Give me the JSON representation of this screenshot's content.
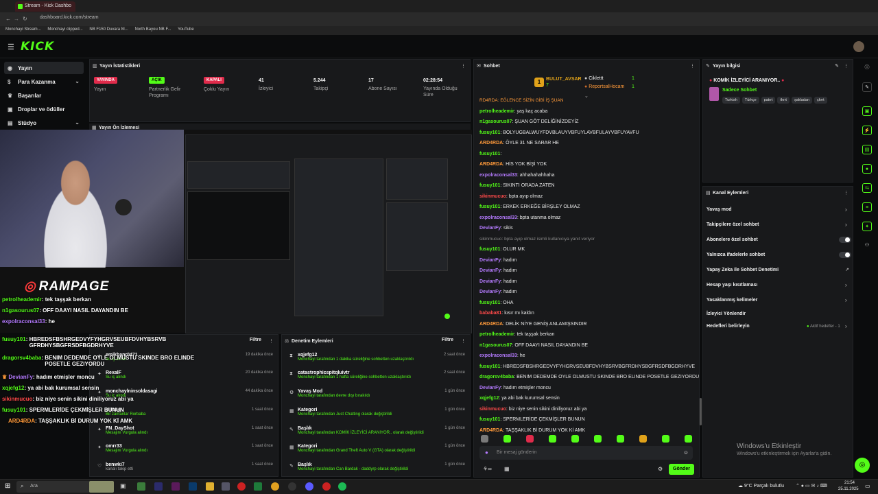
{
  "browser": {
    "tab_title": "Stream - Kick Dashbo",
    "url": "dashboard.kick.com/stream",
    "bookmarks": [
      "Monchayi Stream...",
      "Monchayi clipped...",
      "NB F150 Duvara M...",
      "North Bayou NB F...",
      "YouTube"
    ]
  },
  "header": {
    "logo": "KICK"
  },
  "sidebar": {
    "items": [
      {
        "label": "Yayın",
        "icon": "broadcast-icon"
      },
      {
        "label": "Para Kazanma",
        "icon": "money-icon"
      },
      {
        "label": "Başarılar",
        "icon": "trophy-icon"
      },
      {
        "label": "Droplar ve ödüller",
        "icon": "gift-icon"
      },
      {
        "label": "Stüdyo",
        "icon": "studio-icon"
      }
    ]
  },
  "stats": {
    "title": "Yayın İstatistikleri",
    "items": [
      {
        "badge": "YAYINDA",
        "label": "Yayın"
      },
      {
        "badge": "AÇIK",
        "label": "Partnerlik Gelir Programı"
      },
      {
        "badge": "KAPALI",
        "label": "Çoklu Yayın"
      },
      {
        "value": "41",
        "label": "İzleyici"
      },
      {
        "value": "5.244",
        "label": "Takipçi"
      },
      {
        "value": "17",
        "label": "Abone Sayısı"
      },
      {
        "value": "02:28:54",
        "label": "Yayında Olduğu Süre"
      }
    ]
  },
  "preview": {
    "title": "Yayın Ön İzlemesi",
    "brand": "RAMPAGE"
  },
  "overlay_chat": [
    {
      "user": "petrolheademir",
      "text": "tek taşşak berkan",
      "color": "#53fc18"
    },
    {
      "user": "n1gasourus07",
      "text": "OFF DAAYI NASIL DAYANDIN BE",
      "color": "#53fc18"
    },
    {
      "user": "expolraconsal33",
      "text": "he",
      "color": "#b57bff"
    },
    {
      "user": "fusuy101",
      "text": "HBREDSFBSHRGEDVYFYHGRVSEUBFDVHYBSRVB GFRDHYSBGFRSDFBGDRHYVE",
      "color": "#53fc18"
    },
    {
      "user": "dragorsv4baba",
      "text": "BENIM DEDEMDE OYLE OLMUSTU SKINDE BRO ELINDE POSETLE GEZIYORDU",
      "color": "#53fc18"
    },
    {
      "user": "DevianFy",
      "text": "hadım etmişler moncu",
      "color": "#b57bff"
    },
    {
      "user": "xqjefg12",
      "text": "ya abi bak kurumsal sensin",
      "color": "#53fc18"
    },
    {
      "user": "sikinmucuo",
      "text": "biz niye senin sikini diniliyoruz abi ya",
      "color": "#ff4a4a"
    },
    {
      "user": "fusuy101",
      "text": "SPERMLERİDE ÇEKMİŞLER BUNUN",
      "color": "#53fc18"
    },
    {
      "user": "ARD4RDA",
      "text": "TAŞŞAKLIK Bİ DURUM YOK Kİ AMK",
      "color": "#ff9a3a"
    }
  ],
  "activity": {
    "filter_label": "Filtre",
    "items": [
      {
        "name": "emikhanr0471",
        "sub": "Su iç alındı",
        "time": "19 dakika önce"
      },
      {
        "name": "RexalF",
        "sub": "Su iç alındı",
        "time": "20 dakika önce"
      },
      {
        "name": "monchaylninsoldasagi",
        "sub": "Su iç alındı",
        "time": "44 dakika önce"
      },
      {
        "name": "Mirzag",
        "sub": "Bir zamanlar Rorbaba",
        "time": "1 saat önce"
      },
      {
        "name": "FN_DayShot",
        "sub": "Mesajını Vurgula alındı",
        "time": "1 saat önce"
      },
      {
        "name": "omrr33",
        "sub": "Mesajını Vurgula alındı",
        "time": "1 saat önce"
      },
      {
        "name": "benwki7",
        "sub": "kanalı takip etti",
        "time": "1 saat önce"
      }
    ]
  },
  "moderation": {
    "title": "Denetim Eylemleri",
    "filter_label": "Filtre",
    "items": [
      {
        "name": "xqjefg12",
        "sub": "Monchayi tarafından 1 dakika süreliğine sohbetten uzaklaştırıldı",
        "time": "2 saat önce"
      },
      {
        "name": "catastrophicspitqluivtr",
        "sub": "Monchayi tarafından 1 hafta süreliğine sohbetten uzaklaştırıldı",
        "time": "2 saat önce"
      },
      {
        "name": "Yavaş Mod",
        "sub": "Monchayi tarafından devre dışı bırakıldı",
        "time": "1 gün önce"
      },
      {
        "name": "Kategori",
        "sub": "Monchayi tarafından Just Chatting olarak değiştirildi",
        "time": "1 gün önce"
      },
      {
        "name": "Başlık",
        "sub": "Monchayi tarafından KOMİK İZLEYİCİ ARANIYOR.. olarak değiştirildi",
        "time": "1 gün önce"
      },
      {
        "name": "Kategori",
        "sub": "Monchayi tarafından Grand Theft Auto V (GTA) olarak değiştirildi",
        "time": "1 gün önce"
      },
      {
        "name": "Başlık",
        "sub": "Monchayi tarafından Can Bardak - daddyrp olarak değiştirildi",
        "time": "1 gün önce"
      }
    ]
  },
  "chat": {
    "title": "Sohbet",
    "pinned": {
      "user": "BULUT_AVSAR",
      "count": "7",
      "top1": "Ciklettt",
      "top1_n": "1",
      "top2": "ReportsalHocam",
      "top2_n": "1"
    },
    "messages": [
      {
        "user": "",
        "text": "RD4RDA: EĞLENCE SİZİN GİBİ İŞ ŞUAN",
        "color": "#ff9a3a"
      },
      {
        "user": "petrolheademir",
        "text": "yaş kaç acaba",
        "color": "#53fc18"
      },
      {
        "user": "n1gasourus07",
        "text": "ŞUAN GÖT DELİĞİNİZDEYİZ",
        "color": "#53fc18"
      },
      {
        "user": "fusuy101",
        "text": "BOLYUGBALWUYFDVBLAUYVBFUYLAVBFULAYVBFUYAVFU",
        "color": "#53fc18"
      },
      {
        "user": "ARD4RDA",
        "text": "ÖYLE 31 NE SARAR HE",
        "color": "#ff9a3a"
      },
      {
        "user": "fusuy101",
        "text": "",
        "color": "#53fc18"
      },
      {
        "user": "ARD4RDA",
        "text": "HİS YOK BİŞİ YOK",
        "color": "#ff9a3a"
      },
      {
        "user": "expolraconsal33",
        "text": "ahhahahahhaha",
        "color": "#b57bff"
      },
      {
        "user": "fusuy101",
        "text": "SIKINTI ORADA ZATEN",
        "color": "#53fc18"
      },
      {
        "user": "sikinmucuo",
        "text": "bpta ayıp olmaz",
        "color": "#ff4a4a"
      },
      {
        "user": "fusuy101",
        "text": "ERKEK ERKEĞE BİRŞLEY OLMAZ",
        "color": "#53fc18"
      },
      {
        "user": "expolraconsal33",
        "text": "bpta utanma olmaz",
        "color": "#b57bff"
      },
      {
        "user": "DevianFy",
        "text": "sikis",
        "color": "#b57bff"
      },
      {
        "user": "",
        "text": "sikinmucuo: bpta ayıp olmaz isimli kullanıcıya yanıt veriyor",
        "color": "#888"
      },
      {
        "user": "fusuy101",
        "text": "OLUR MK",
        "color": "#53fc18"
      },
      {
        "user": "DevianFy",
        "text": "hadım",
        "color": "#b57bff"
      },
      {
        "user": "DevianFy",
        "text": "hadım",
        "color": "#b57bff"
      },
      {
        "user": "DevianFy",
        "text": "hadım",
        "color": "#b57bff"
      },
      {
        "user": "DevianFy",
        "text": "hadım",
        "color": "#b57bff"
      },
      {
        "user": "fusuy101",
        "text": "OHA",
        "color": "#53fc18"
      },
      {
        "user": "bababa81",
        "text": "kısır mı kaldın",
        "color": "#ff4a4a"
      },
      {
        "user": "ARD4RDA",
        "text": "DELİK NİYE GENİŞ ANLAMIŞSINDIR",
        "color": "#ff9a3a"
      },
      {
        "user": "petrolheademir",
        "text": "tek taşşak berkan",
        "color": "#53fc18"
      },
      {
        "user": "n1gasourus07",
        "text": "OFF DAAYI NASIL DAYANDIN BE",
        "color": "#53fc18"
      },
      {
        "user": "expolraconsal33",
        "text": "he",
        "color": "#b57bff"
      },
      {
        "user": "fusuy101",
        "text": "HBREDSFBSHRGEDVYFYHGRVSEUBFDVHYBSRVBGFRDHYSBGFRSDFBGDRHYVE",
        "color": "#53fc18"
      },
      {
        "user": "dragorsv4baba",
        "text": "BENIM DEDEMDE OYLE OLMUSTU SKINDE BRO ELINDE POSETLE GEZIYORDU",
        "color": "#53fc18"
      },
      {
        "user": "DevianFy",
        "text": "hadım etmişler moncu",
        "color": "#b57bff"
      },
      {
        "user": "xqjefg12",
        "text": "ya abi bak kurumsal sensin",
        "color": "#53fc18"
      },
      {
        "user": "sikinmucuo",
        "text": "biz niye senin sikini diniliyoruz abi ya",
        "color": "#ff4a4a"
      },
      {
        "user": "fusuy101",
        "text": "SPERMLERİDE ÇEKMİŞLER BUNUN",
        "color": "#53fc18"
      },
      {
        "user": "ARD4RDA",
        "text": "TAŞŞAKLIK Bİ DURUM YOK Kİ AMK",
        "color": "#ff9a3a"
      }
    ],
    "input_placeholder": "Bir mesaj gönderin",
    "send_label": "Gönder"
  },
  "stream_info": {
    "title": "Yayın bilgisi",
    "stream_title": "KOMİK İZLEYİCİ ARANIYOR..",
    "category": "Sadece Sohbet",
    "tags": [
      "Turkish",
      "Türkçe",
      "patrrt",
      "tkrrt",
      "şakladan",
      "çkrrt"
    ]
  },
  "channel_actions": {
    "title": "Kanal Eylemleri",
    "rows": [
      {
        "label": "Yavaş mod",
        "kind": "arrow"
      },
      {
        "label": "Takipçilere özel sohbet",
        "kind": "arrow"
      },
      {
        "label": "Abonelere özel sohbet",
        "kind": "toggle"
      },
      {
        "label": "Yalnızca ifadelerle sohbet",
        "kind": "toggle"
      },
      {
        "label": "Yapay Zeka ile Sohbet Denetimi",
        "kind": "external"
      },
      {
        "label": "Hesap yaşı kısıtlaması",
        "kind": "arrow"
      },
      {
        "label": "Yasaklanmış kelimeler",
        "kind": "arrow"
      },
      {
        "label": "İzleyici Yönlendir",
        "kind": "none"
      },
      {
        "label": "Hedefleri belirleyin",
        "kind": "arrow"
      }
    ],
    "goals_status": "Aktif hedefler - 1"
  },
  "windows": {
    "activate_title": "Windows'u Etkinleştir",
    "activate_sub": "Windows'u etkinleştirmek için Ayarlar'a gidin."
  },
  "taskbar": {
    "search_placeholder": "Ara",
    "weather": "9°C Parçalı bulutlu",
    "time": "21:54",
    "date": "25.11.2025"
  },
  "colors": {
    "accent": "#53fc18",
    "live": "#e02b4b",
    "panel": "#18191b"
  }
}
